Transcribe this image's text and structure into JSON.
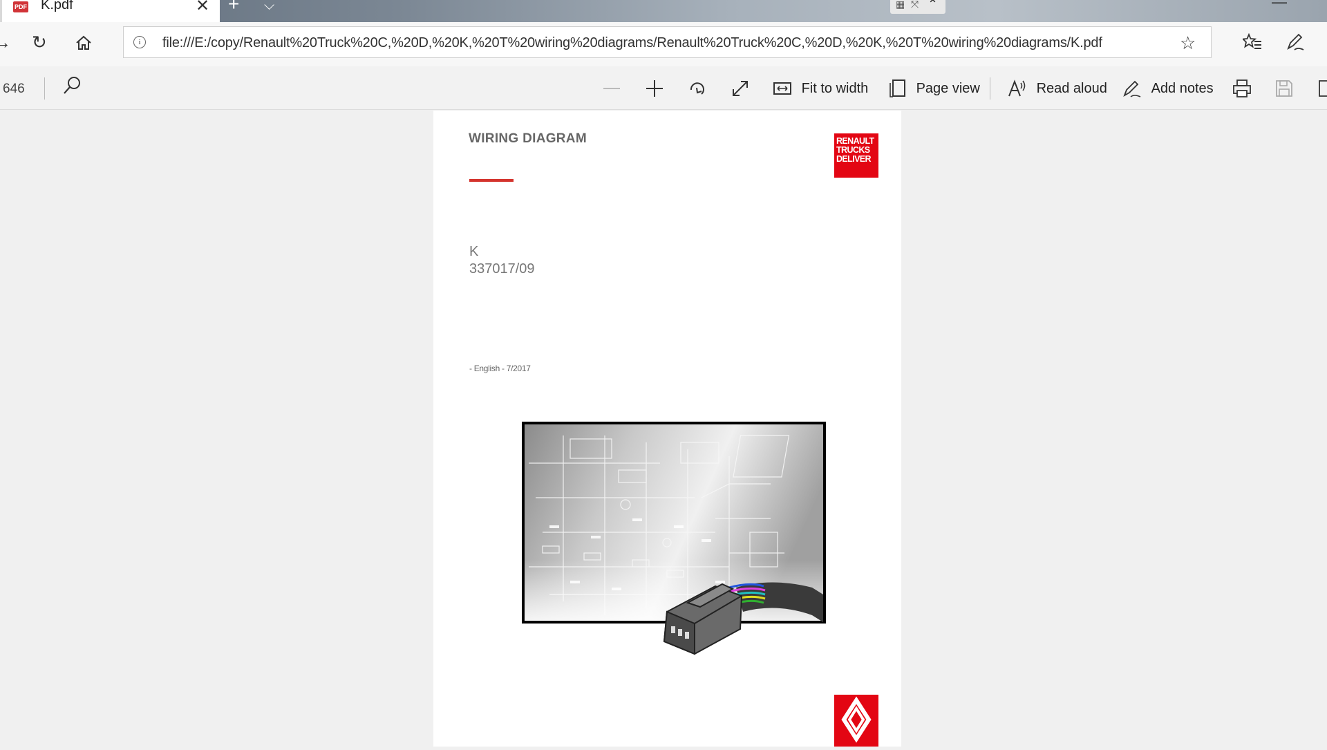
{
  "browser": {
    "tab": {
      "title": "K.pdf",
      "icon": "pdf-icon",
      "icon_text": "PDF"
    },
    "address_bar": {
      "url": "file:///E:/copy/Renault%20Truck%20C,%20D,%20K,%20T%20wiring%20diagrams/Renault%20Truck%20C,%20D,%20K,%20T%20wiring%20diagrams/K.pdf"
    }
  },
  "pdf_toolbar": {
    "page_count": "646",
    "fit_to_width": "Fit to width",
    "page_view": "Page view",
    "read_aloud": "Read aloud",
    "add_notes": "Add notes"
  },
  "document": {
    "title": "WIRING DIAGRAM",
    "brand_lines": [
      "RENAULT",
      "TRUCKS",
      "DELIVER"
    ],
    "model": "K",
    "code": "337017/09",
    "language_date": "- English - 7/2017"
  },
  "colors": {
    "brand_red": "#e30613",
    "accent_line": "#d4332d",
    "viewer_bg": "#f0f0f0"
  }
}
